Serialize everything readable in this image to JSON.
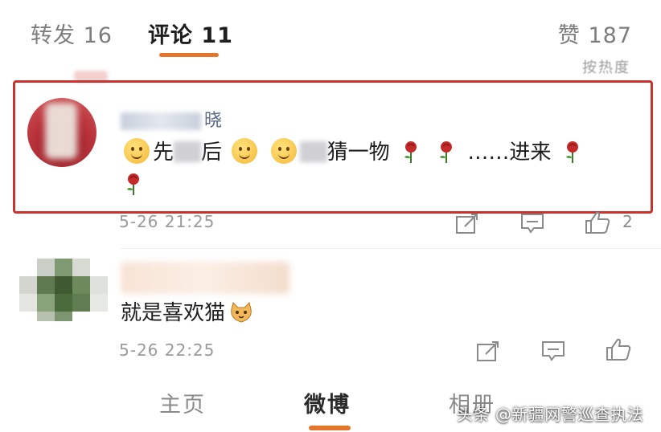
{
  "tabs": {
    "repost": "转发 16",
    "comment": "评论 11",
    "like": "赞 187"
  },
  "sort_label": "按热度",
  "comments": [
    {
      "username_visible": "晓",
      "username_prefix": "新",
      "text_parts": [
        "先",
        "后",
        "猜一物",
        "……进来"
      ],
      "time": "5-26 21:25",
      "like_count": "2"
    },
    {
      "text": "就是喜欢猫",
      "time": "5-26 22:25"
    }
  ],
  "bottom_nav": {
    "home": "主页",
    "weibo": "微博",
    "album": "相册"
  },
  "watermark": "头条 @新疆网警巡查执法",
  "colors": {
    "accent": "#e3762b",
    "highlight_border": "#c8322f",
    "username": "#5c6a8a",
    "meta": "#9a9a9a"
  }
}
